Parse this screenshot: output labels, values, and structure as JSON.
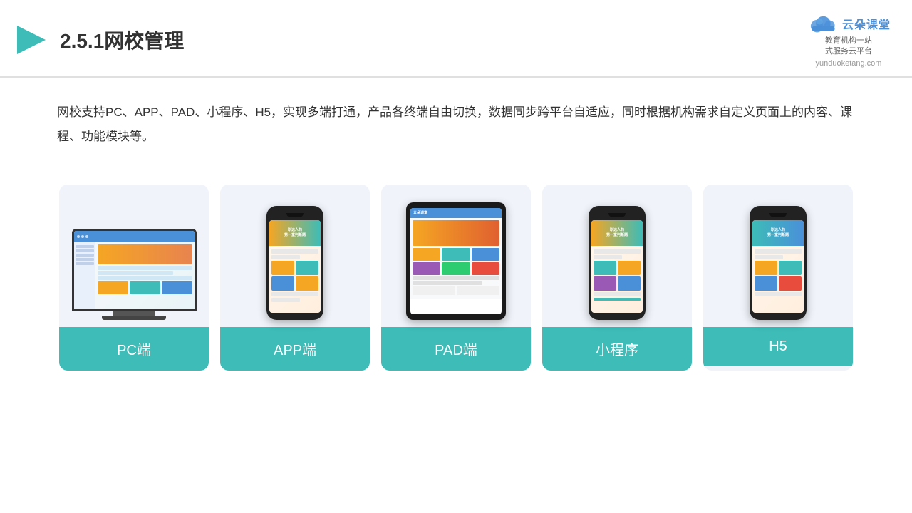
{
  "header": {
    "title": "2.5.1网校管理",
    "logo": {
      "main_text": "云朵课堂",
      "domain": "yunduoketang.com",
      "tagline_line1": "教育机构一站",
      "tagline_line2": "式服务云平台"
    }
  },
  "description": {
    "text": "网校支持PC、APP、PAD、小程序、H5，实现多端打通，产品各终端自由切换，数据同步跨平台自适应，同时根据机构需求自定义页面上的内容、课程、功能模块等。"
  },
  "cards": [
    {
      "id": "pc",
      "label": "PC端"
    },
    {
      "id": "app",
      "label": "APP端"
    },
    {
      "id": "pad",
      "label": "PAD端"
    },
    {
      "id": "miniprogram",
      "label": "小程序"
    },
    {
      "id": "h5",
      "label": "H5"
    }
  ],
  "colors": {
    "teal": "#3dbcb8",
    "blue": "#4a90d9",
    "accent_orange": "#f5a623",
    "card_bg": "#eef2fa",
    "dark": "#333333"
  }
}
